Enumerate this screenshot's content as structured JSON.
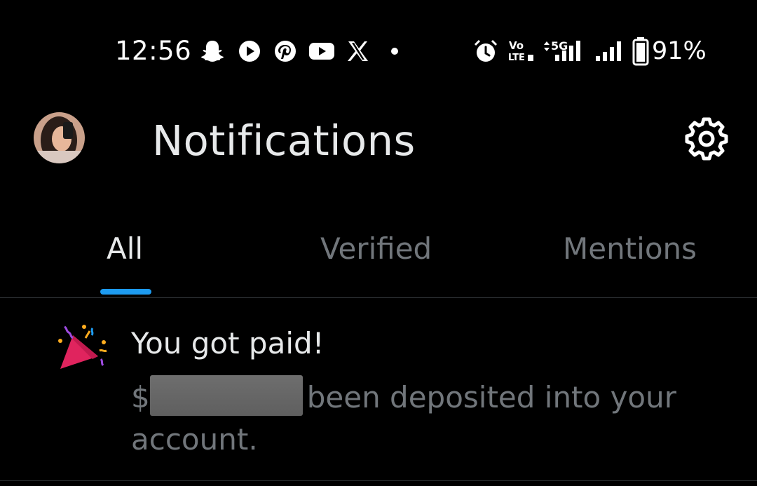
{
  "status_bar": {
    "time": "12:56",
    "battery": "91%",
    "network": "5G",
    "volte": "Vo LTE",
    "icons": [
      "snapchat-icon",
      "play-icon",
      "pinterest-icon",
      "youtube-icon",
      "x-icon",
      "dot-icon",
      "alarm-icon",
      "volte-icon",
      "signal-5g-icon",
      "signal-icon",
      "battery-icon"
    ]
  },
  "header": {
    "title": "Notifications",
    "avatar": "avatar",
    "settings_icon": "gear-icon"
  },
  "tabs": [
    {
      "label": "All",
      "active": true
    },
    {
      "label": "Verified",
      "active": false
    },
    {
      "label": "Mentions",
      "active": false
    }
  ],
  "notification": {
    "icon": "party-popper-icon",
    "title": "You got paid!",
    "body_prefix": "$",
    "body_rest": "been deposited into your account."
  },
  "colors": {
    "background": "#000000",
    "text_primary": "#e7e9ea",
    "text_secondary": "#71767b",
    "accent": "#1d9bf0",
    "divider": "#2f3336"
  }
}
